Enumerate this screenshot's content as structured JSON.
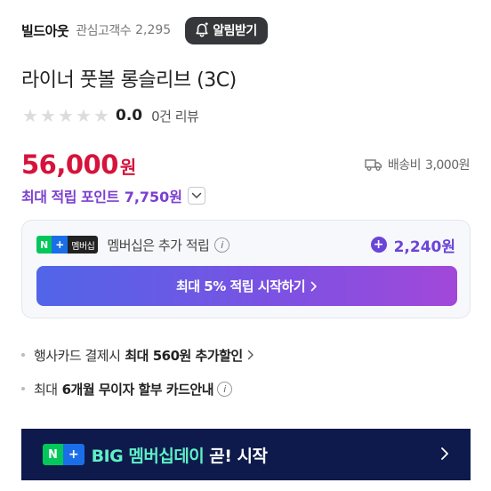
{
  "store": {
    "name": "빌드아웃",
    "fav_label": "관심고객수",
    "fav_count": "2,295",
    "alarm_label": "알림받기"
  },
  "product": {
    "title": "라이너 풋볼 롱슬리브 (3C)"
  },
  "rating": {
    "stars_filled": 0,
    "stars_total": 5,
    "score": "0.0",
    "review_count": "0건 리뷰"
  },
  "price": {
    "amount": "56,000",
    "unit": "원"
  },
  "shipping": {
    "label": "배송비",
    "fee": "3,000원"
  },
  "points": {
    "label": "최대 적립 포인트",
    "amount": "7,750원"
  },
  "membership": {
    "badge_n": "N",
    "badge_plus": "+",
    "badge_label": "멤버십",
    "desc": "멤버십은 추가 적립",
    "info_glyph": "i",
    "plus_glyph": "+",
    "extra_amount": "2,240원",
    "cta_label": "최대 5% 적립 시작하기"
  },
  "benefits": {
    "card_prefix": "행사카드 결제시",
    "card_bold": "최대 560원 추가할인",
    "install_prefix": "최대",
    "install_bold": "6개월 무이자 할부 카드안내",
    "info_glyph": "i"
  },
  "banner": {
    "badge_n": "N",
    "badge_plus": "+",
    "highlight": "BIG 멤버십데이",
    "text": "곧! 시작"
  },
  "colors": {
    "price_red": "#d6133b",
    "point_purple": "#7b3fd1",
    "naver_green": "#03c75a",
    "banner_navy": "#0e1a4c",
    "banner_mint": "#5ef0c6"
  }
}
